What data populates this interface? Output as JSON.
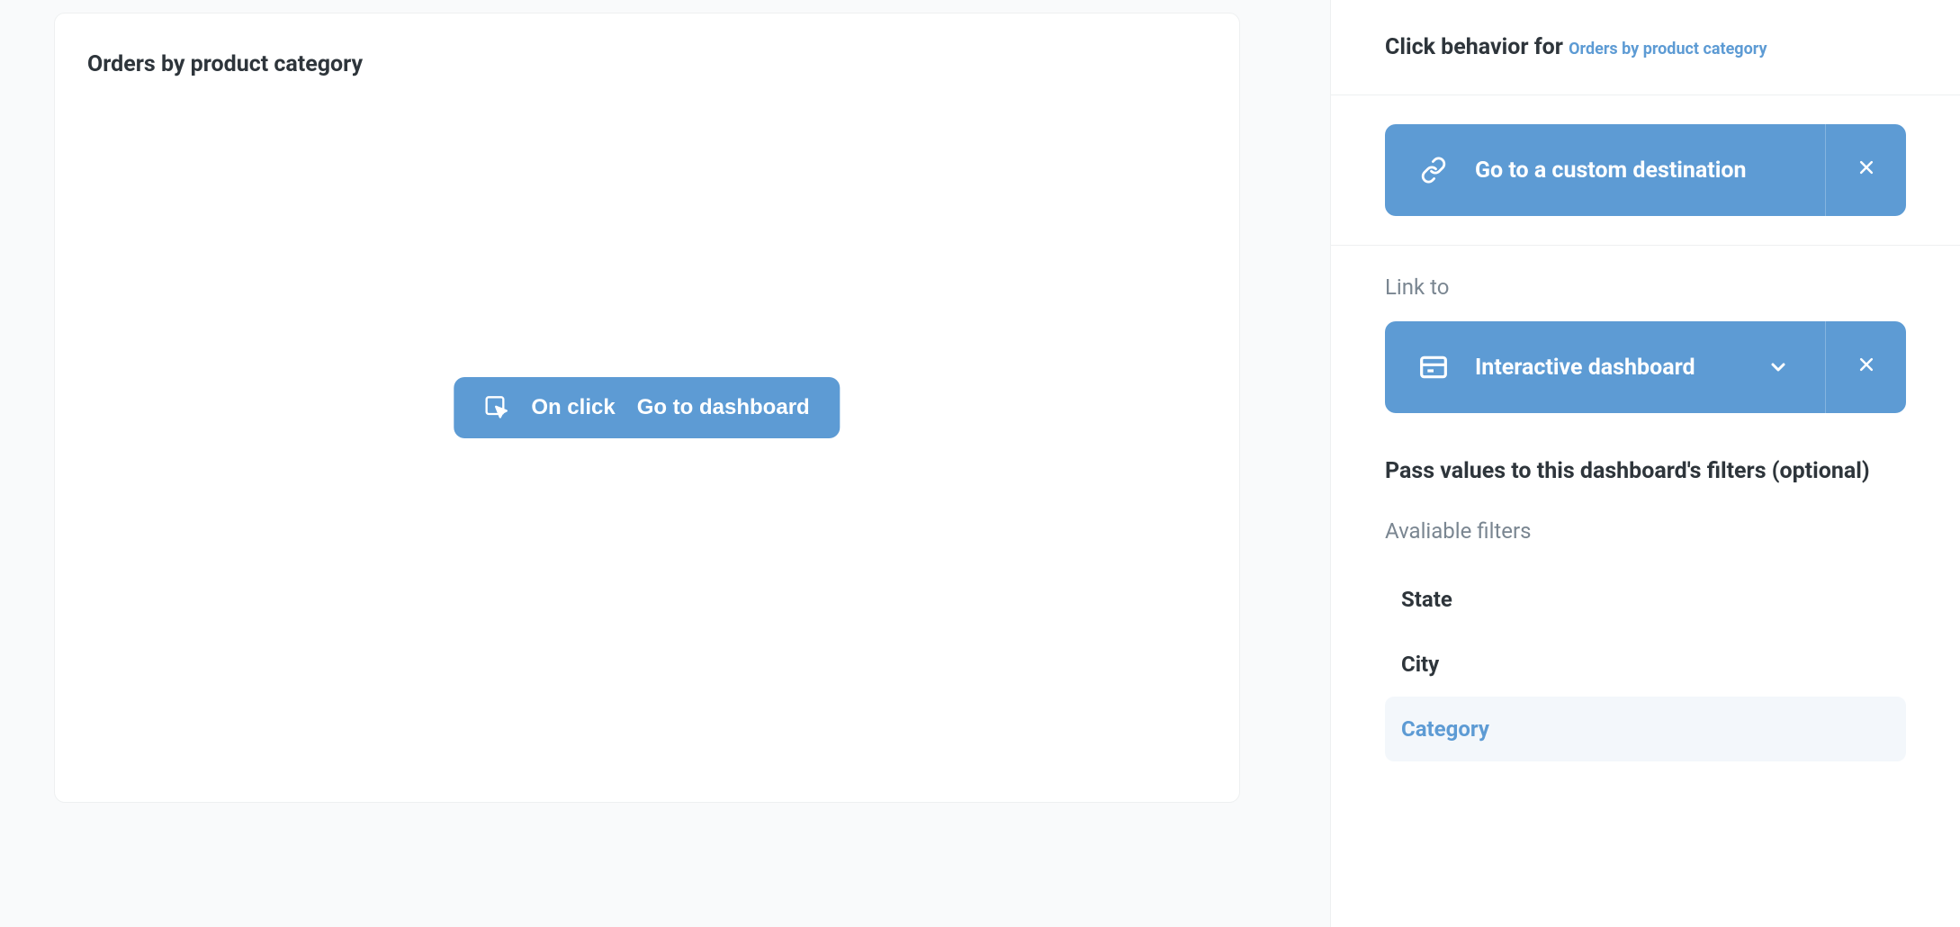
{
  "card": {
    "title": "Orders by product category",
    "pill": {
      "label_left": "On click",
      "label_right": "Go to dashboard"
    }
  },
  "panel": {
    "header": {
      "prefix": "Click behavior for ",
      "link_text": "Orders by product category"
    },
    "destination": {
      "label": "Go to a custom destination"
    },
    "link_to": {
      "section_label": "Link to",
      "selected": "Interactive dashboard"
    },
    "pass_values": {
      "title": "Pass values to this dashboard's filters (optional)",
      "available_label": "Avaliable filters",
      "filters": [
        {
          "name": "State",
          "selected": false
        },
        {
          "name": "City",
          "selected": false
        },
        {
          "name": "Category",
          "selected": true
        }
      ]
    }
  }
}
